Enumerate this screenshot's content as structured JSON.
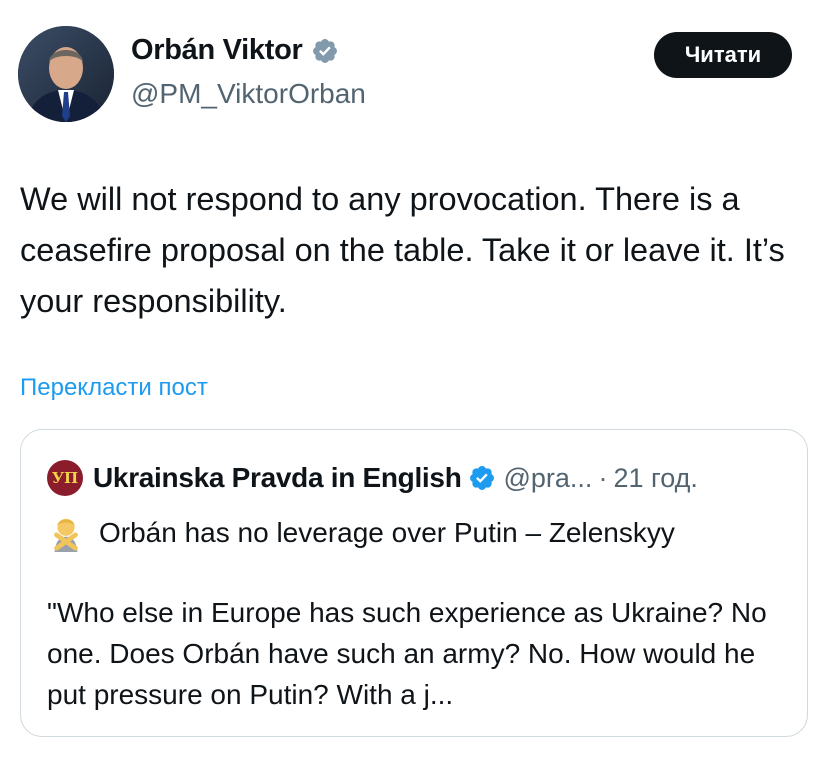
{
  "author": {
    "name": "Orbán Viktor",
    "handle": "@PM_ViktorOrban"
  },
  "follow_button": {
    "label": "Читати"
  },
  "tweet": {
    "text": "We will not respond to any provocation. There is a ceasefire proposal on the table. Take it or leave it. It’s your responsibility.",
    "translate_label": "Перекласти пост"
  },
  "quoted": {
    "logo_text": "УП",
    "author_name": "Ukrainska Pravda in English",
    "handle": "@pra...",
    "separator": "·",
    "time": "21 год.",
    "title": "Orbán has no leverage over Putin – Zelenskyy",
    "body": "\"Who else in Europe has such experience as Ukraine? No one. Does Orbán have such an army? No. How would he put pressure on Putin? With a j..."
  },
  "colors": {
    "text": "#0f1419",
    "secondary": "#536471",
    "link": "#1d9bf0",
    "verified": "#1d9bf0",
    "button_bg": "#0f1419",
    "border": "#cfd9de"
  },
  "icons": {
    "verified": "verified-badge-icon",
    "title_emoji": "person-gesturing-no-icon"
  }
}
